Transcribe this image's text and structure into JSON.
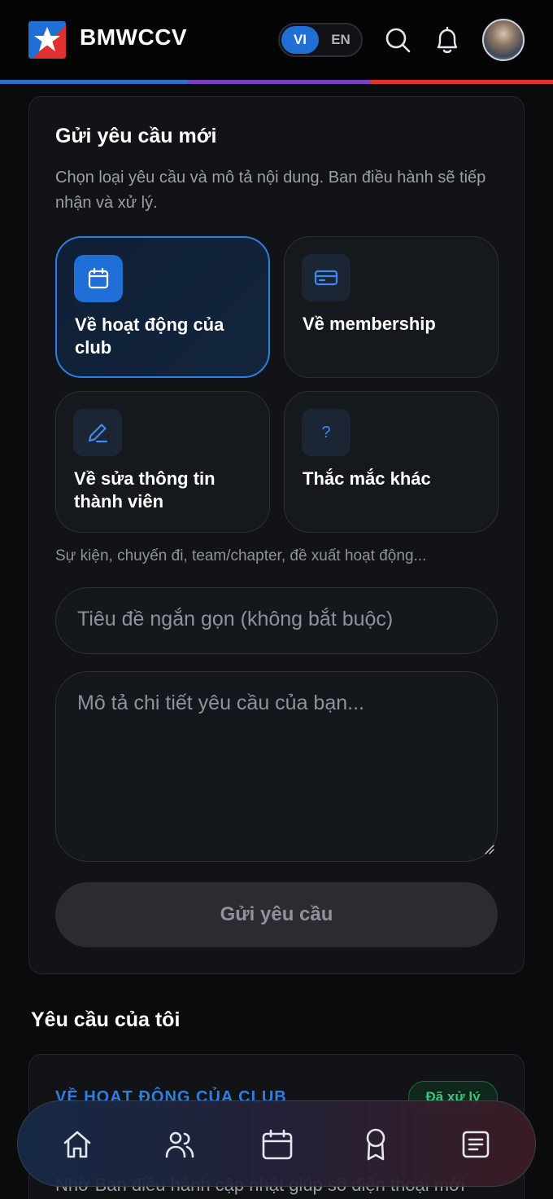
{
  "header": {
    "brand": "BMWCCV",
    "lang_vi": "VI",
    "lang_en": "EN",
    "active_lang": "VI"
  },
  "form": {
    "title": "Gửi yêu cầu mới",
    "description": "Chọn loại yêu cầu và mô tả nội dung. Ban điều hành sẽ tiếp nhận và xử lý.",
    "types": [
      {
        "label": "Về hoạt động của club",
        "icon": "calendar-icon",
        "selected": true
      },
      {
        "label": "Về membership",
        "icon": "card-icon",
        "selected": false
      },
      {
        "label": "Về sửa thông tin thành viên",
        "icon": "pencil-icon",
        "selected": false
      },
      {
        "label": "Thắc mắc khác",
        "icon": "question-icon",
        "selected": false
      }
    ],
    "question_mark": "?",
    "hint": "Sự kiện, chuyến đi, team/chapter, đề xuất hoạt động...",
    "title_placeholder": "Tiêu đề ngắn gọn (không bắt buộc)",
    "detail_placeholder": "Mô tả chi tiết yêu cầu của bạn...",
    "submit_label": "Gửi yêu cầu"
  },
  "my_requests": {
    "title": "Yêu cầu của tôi",
    "items": [
      {
        "category": "VỀ HOẠT ĐỘNG CỦA CLUB",
        "status": "Đã xử lý",
        "text": "Nhờ Ban điều hành cập nhật giúp số điện thoại mới"
      }
    ]
  },
  "bottom_nav": [
    "home-icon",
    "members-icon",
    "calendar-icon",
    "badge-icon",
    "notes-icon"
  ],
  "colors": {
    "accent": "#1f6fd6",
    "background": "#0a0b0d",
    "card": "#111317",
    "status_done": "#3cc47a"
  }
}
